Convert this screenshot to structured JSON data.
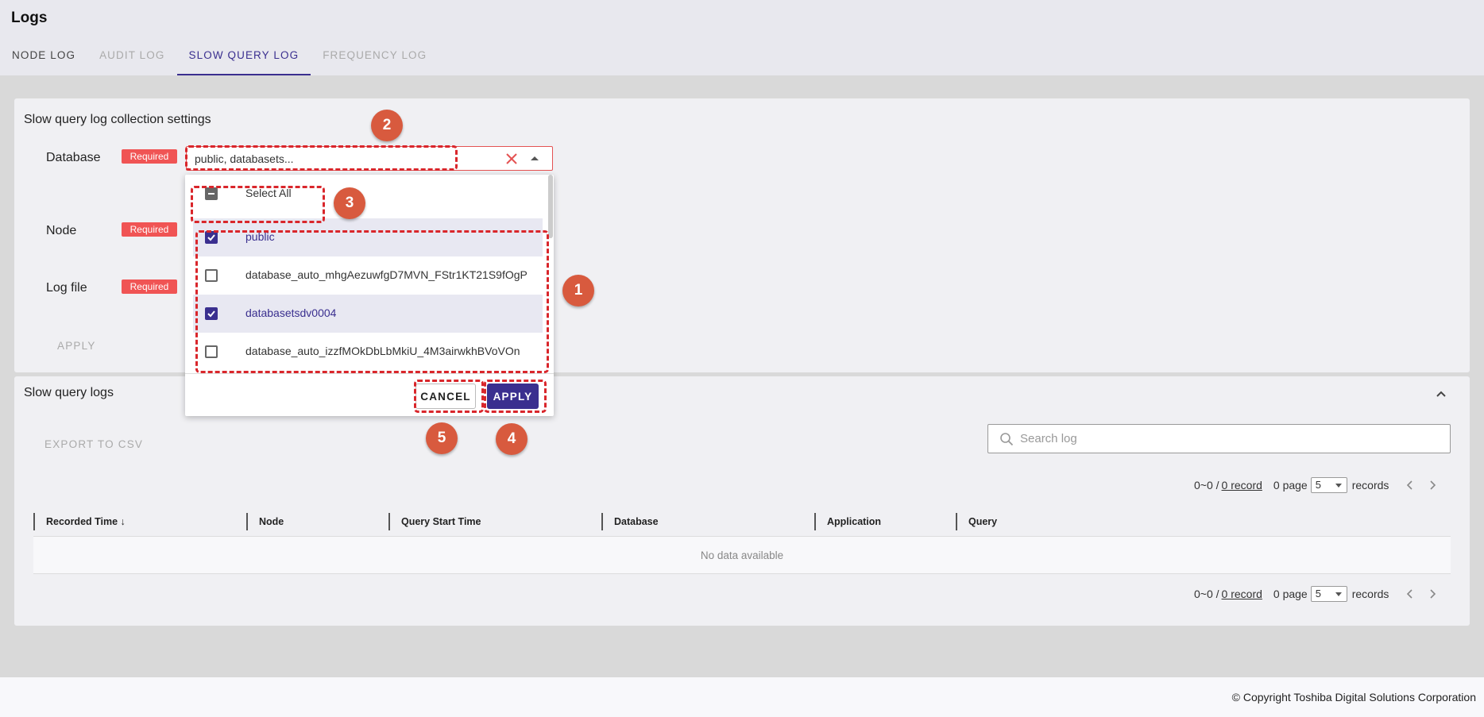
{
  "header": {
    "title": "Logs",
    "tabs": [
      {
        "label": "NODE LOG",
        "state": "normal"
      },
      {
        "label": "AUDIT LOG",
        "state": "disabled"
      },
      {
        "label": "SLOW QUERY LOG",
        "state": "active"
      },
      {
        "label": "FREQUENCY LOG",
        "state": "disabled"
      }
    ]
  },
  "settings": {
    "title": "Slow query log collection settings",
    "database_label": "Database",
    "node_label": "Node",
    "logfile_label": "Log file",
    "required_label": "Required",
    "database_value": "public, databasets...",
    "apply_label": "APPLY"
  },
  "dropdown": {
    "select_all_label": "Select All",
    "items": [
      {
        "label": "public",
        "checked": true
      },
      {
        "label": "database_auto_mhgAezuwfgD7MVN_FStr1KT21S9fOgP",
        "checked": false
      },
      {
        "label": "databasetsdv0004",
        "checked": true
      },
      {
        "label": "database_auto_izzfMOkDbLbMkiU_4M3airwkhBVoVOn",
        "checked": false
      }
    ],
    "cancel_label": "CANCEL",
    "apply_label": "APPLY"
  },
  "logs": {
    "title": "Slow query logs",
    "export_label": "EXPORT TO CSV",
    "search_placeholder": "Search log",
    "pager": {
      "range": "0~0 /",
      "records_link": "0 record",
      "pages": "0 page",
      "per_page": "5",
      "records_label": "records"
    },
    "columns": [
      "Recorded Time ↓",
      "Node",
      "Query Start Time",
      "Database",
      "Application",
      "Query"
    ],
    "empty_text": "No data available"
  },
  "footer": {
    "copyright": "© Copyright Toshiba Digital Solutions Corporation"
  },
  "annotations": [
    "1",
    "2",
    "3",
    "4",
    "5"
  ],
  "colors": {
    "accent": "#3a2f8f",
    "required": "#f05454",
    "annotation_marker": "#d85a3e",
    "annotation_dash": "#d9262b"
  }
}
